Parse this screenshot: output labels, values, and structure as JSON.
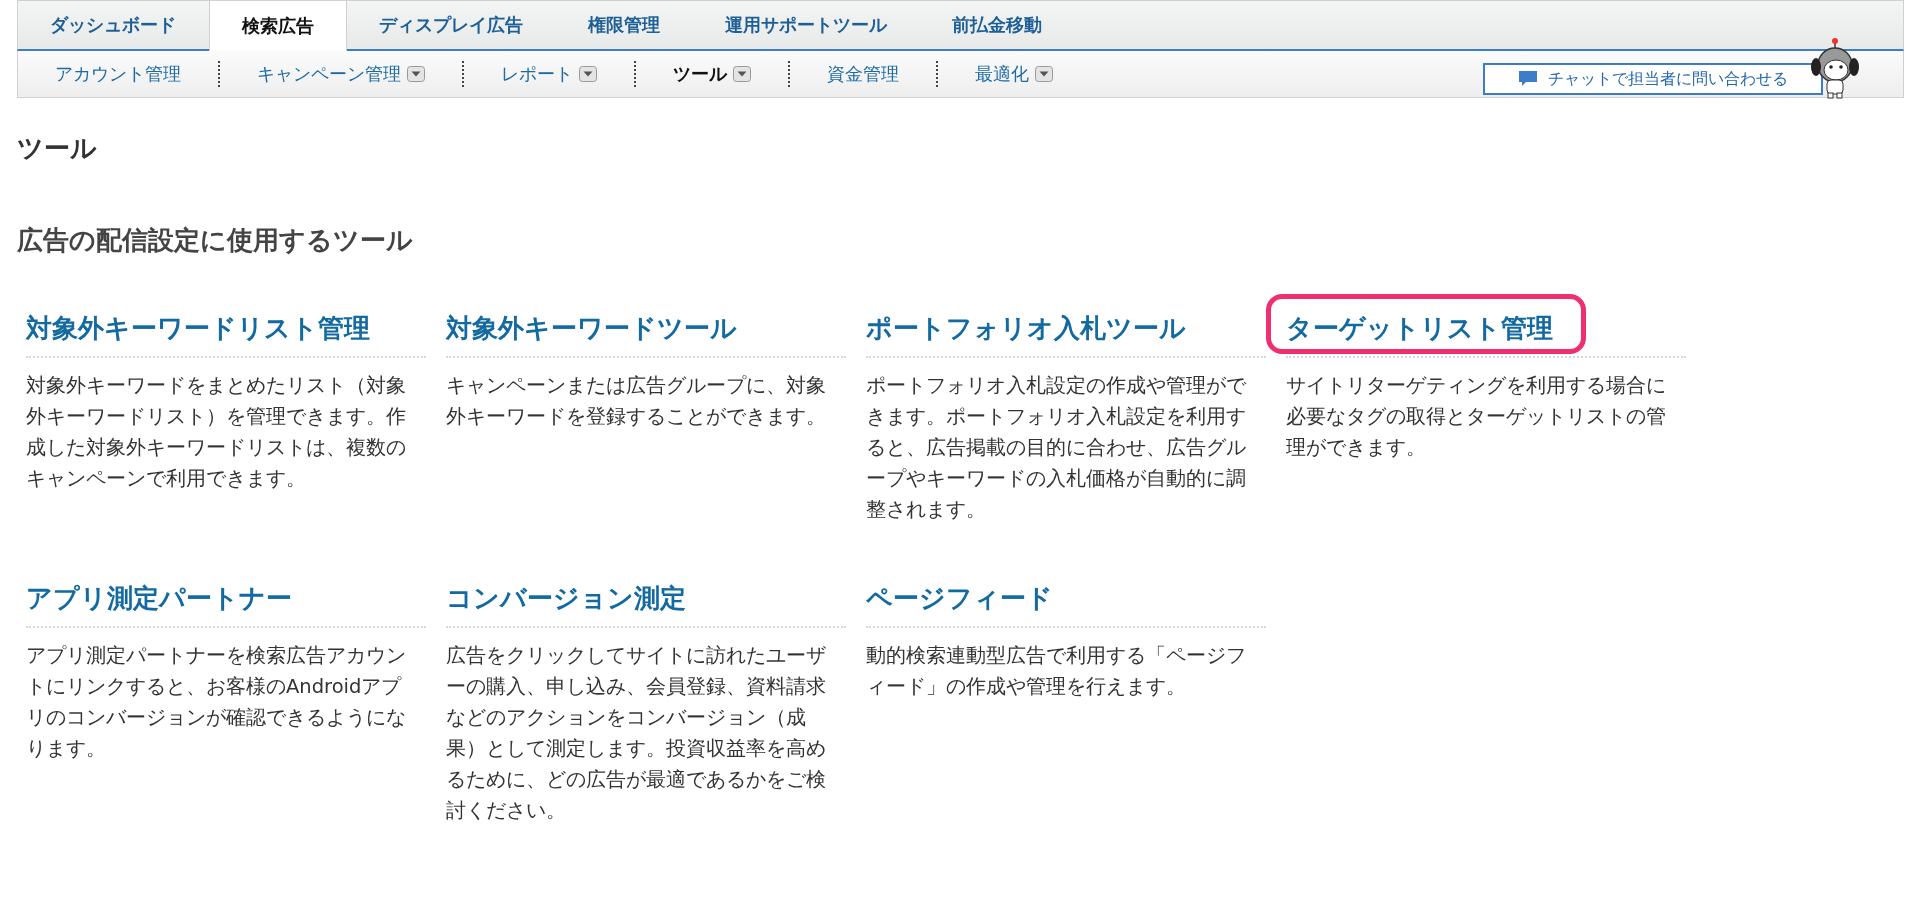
{
  "tabs": [
    {
      "label": "ダッシュボード",
      "selected": false
    },
    {
      "label": "検索広告",
      "selected": true
    },
    {
      "label": "ディスプレイ広告",
      "selected": false
    },
    {
      "label": "権限管理",
      "selected": false
    },
    {
      "label": "運用サポートツール",
      "selected": false
    },
    {
      "label": "前払金移動",
      "selected": false
    }
  ],
  "subnav": [
    {
      "label": "アカウント管理",
      "selected": false,
      "dropdown": false
    },
    {
      "label": "キャンペーン管理",
      "selected": false,
      "dropdown": true
    },
    {
      "label": "レポート",
      "selected": false,
      "dropdown": true
    },
    {
      "label": "ツール",
      "selected": true,
      "dropdown": true
    },
    {
      "label": "資金管理",
      "selected": false,
      "dropdown": false
    },
    {
      "label": "最適化",
      "selected": false,
      "dropdown": true
    }
  ],
  "chat_button": {
    "label": "チャットで担当者に問い合わせる"
  },
  "page_title": "ツール",
  "section_title": "広告の配信設定に使用するツール",
  "cards": [
    {
      "title": "対象外キーワードリスト管理",
      "description": "対象外キーワードをまとめたリスト（対象外キーワードリスト）を管理できます。作成した対象外キーワードリストは、複数のキャンペーンで利用できます。",
      "highlighted": false
    },
    {
      "title": "対象外キーワードツール",
      "description": "キャンペーンまたは広告グループに、対象外キーワードを登録することができます。",
      "highlighted": false
    },
    {
      "title": "ポートフォリオ入札ツール",
      "description": "ポートフォリオ入札設定の作成や管理ができます。ポートフォリオ入札設定を利用すると、広告掲載の目的に合わせ、広告グループやキーワードの入札価格が自動的に調整されます。",
      "highlighted": false
    },
    {
      "title": "ターゲットリスト管理",
      "description": "サイトリターゲティングを利用する場合に必要なタグの取得とターゲットリストの管理ができます。",
      "highlighted": true
    },
    {
      "title": "アプリ測定パートナー",
      "description": "アプリ測定パートナーを検索広告アカウントにリンクすると、お客様のAndroidアプリのコンバージョンが確認できるようになります。",
      "highlighted": false
    },
    {
      "title": "コンバージョン測定",
      "description": "広告をクリックしてサイトに訪れたユーザーの購入、申し込み、会員登録、資料請求などのアクションをコンバージョン（成果）として測定します。投資収益率を高めるために、どの広告が最適であるかをご検討ください。",
      "highlighted": false
    },
    {
      "title": "ページフィード",
      "description": "動的検索連動型広告で利用する「ページフィード」の作成や管理を行えます。",
      "highlighted": false
    }
  ]
}
